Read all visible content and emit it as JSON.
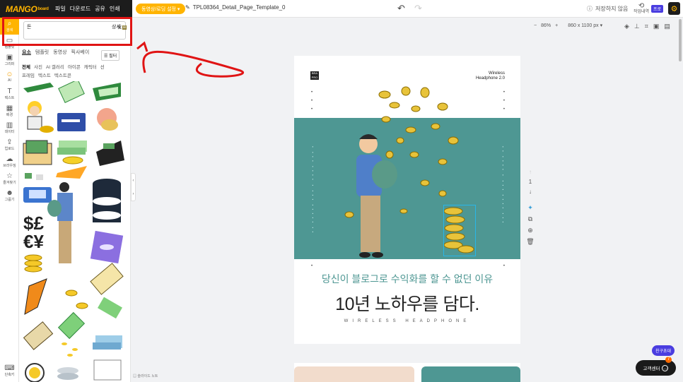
{
  "topbar": {
    "logo": "MANGO",
    "logo_sub": "board",
    "menu": [
      "파일",
      "다운로드",
      "공유",
      "인쇄"
    ],
    "premium_button": "동영상/로딩 설정",
    "document_title": "TPL08364_Detail_Page_Template_0",
    "save_status": "저장하지 않음",
    "history_label": "작업내역",
    "pro_badge": "프로"
  },
  "leftrail": {
    "items": [
      {
        "label": "검색",
        "icon": "search-icon"
      },
      {
        "label": "템플릿",
        "icon": "template-icon"
      },
      {
        "label": "그리퍼",
        "icon": "image-icon"
      },
      {
        "label": "AI",
        "icon": "ai-icon"
      },
      {
        "label": "텍스트",
        "icon": "text-icon"
      },
      {
        "label": "배경",
        "icon": "background-icon"
      },
      {
        "label": "데이터",
        "icon": "chart-icon"
      },
      {
        "label": "업로드",
        "icon": "upload-icon"
      },
      {
        "label": "브라우징",
        "icon": "browse-icon"
      },
      {
        "label": "즐겨찾기",
        "icon": "star-icon"
      },
      {
        "label": "그룹기",
        "icon": "group-icon"
      }
    ],
    "bottom_label": "단축키"
  },
  "panel": {
    "search_value": "돈",
    "detail_label": "상세",
    "tabs": [
      "요소",
      "템플릿",
      "동영상",
      "픽사베이"
    ],
    "filter_label": "필터",
    "subtabs": [
      "전체",
      "사진",
      "AI 갤러리",
      "아이콘",
      "캐릭터",
      "선",
      "프레임",
      "텍스트",
      "텍스트콘"
    ],
    "slide_note": "슬라이드 노트"
  },
  "toolbar": {
    "zoom_minus": "−",
    "zoom": "86%",
    "zoom_plus": "+",
    "page_size": "860 x 1100 px"
  },
  "page": {
    "brand": "BRA PRO",
    "brand_line1": "Wireless",
    "brand_line2": "Headphone 2.0",
    "subtitle": "당신이 블로그로 수익화를 할 수 없던 이유",
    "headline": "10년 노하우를 담다.",
    "eng": "WIRELESS HEADPHONE",
    "page_number": "1"
  },
  "floating": {
    "invite": "친구초대",
    "support": "고객센터",
    "support_count": "7"
  }
}
